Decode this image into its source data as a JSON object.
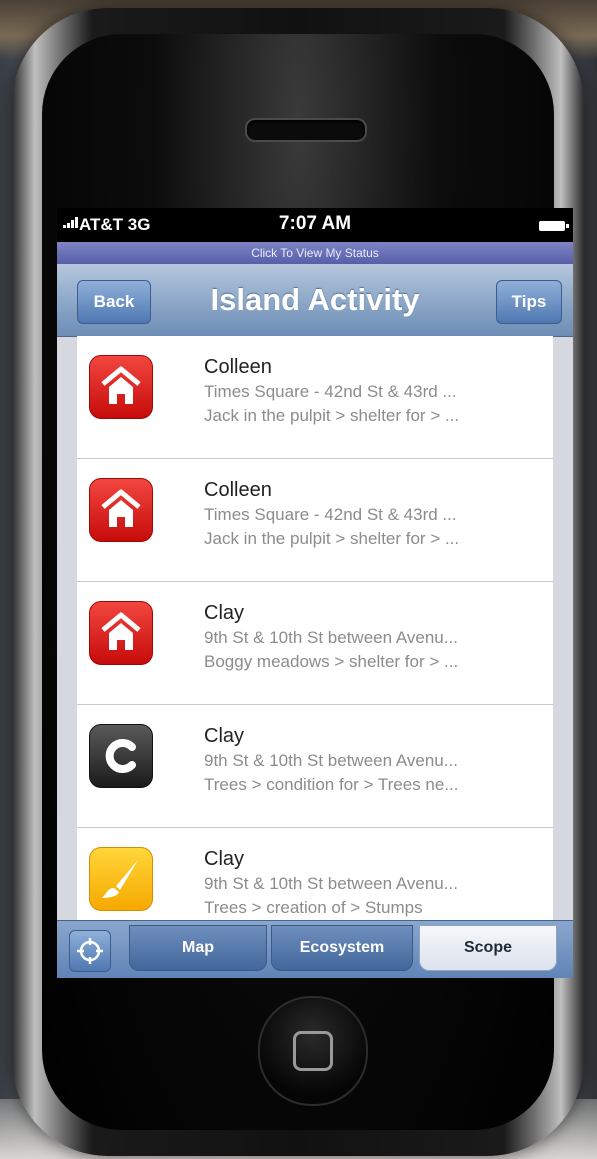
{
  "status_bar": {
    "carrier": "AT&T 3G",
    "time": "7:07 AM"
  },
  "status_link": "Click To View My Status",
  "nav": {
    "back_label": "Back",
    "title": "Island Activity",
    "tips_label": "Tips"
  },
  "list": {
    "items": [
      {
        "icon": "house-icon",
        "title": "Colleen",
        "line1": "Times Square - 42nd St & 43rd ...",
        "line2": "Jack in the pulpit > shelter for > ..."
      },
      {
        "icon": "house-icon",
        "title": "Colleen",
        "line1": "Times Square - 42nd St & 43rd ...",
        "line2": "Jack in the pulpit > shelter for > ..."
      },
      {
        "icon": "house-icon",
        "title": "Clay",
        "line1": "9th St & 10th St between Avenu...",
        "line2": "Boggy meadows > shelter for > ..."
      },
      {
        "icon": "letter-c-icon",
        "title": "Clay",
        "line1": "9th St & 10th St between Avenu...",
        "line2": "Trees > condition for > Trees ne..."
      },
      {
        "icon": "paintbrush-icon",
        "title": "Clay",
        "line1": "9th St & 10th St between Avenu...",
        "line2": "Trees > creation of > Stumps"
      }
    ]
  },
  "tab_bar": {
    "locate_icon": "crosshair-icon",
    "tabs": [
      {
        "label": "Map",
        "selected": false
      },
      {
        "label": "Ecosystem",
        "selected": false
      },
      {
        "label": "Scope",
        "selected": true
      }
    ]
  },
  "colors": {
    "nav_blue": "#8ea9c9",
    "status_link_purple": "#575ea8",
    "shelter_red": "#d9231f",
    "condition_dark": "#2e2e2e",
    "creation_yellow": "#fbc21a"
  }
}
